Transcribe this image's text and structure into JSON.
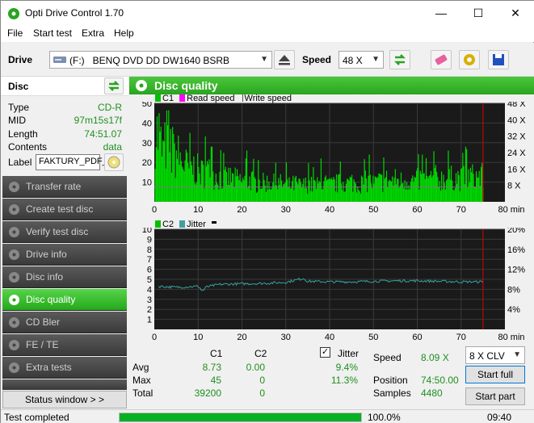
{
  "window": {
    "title": "Opti Drive Control 1.70"
  },
  "menu": [
    "File",
    "Start test",
    "Extra",
    "Help"
  ],
  "toolbar": {
    "drive_label": "Drive",
    "drive_value": "(F:)   BENQ DVD DD DW1640 BSRB",
    "speed_label": "Speed",
    "speed_value": "48 X"
  },
  "disc": {
    "header": "Disc",
    "type_label": "Type",
    "type_value": "CD-R",
    "mid_label": "MID",
    "mid_value": "97m15s17f",
    "length_label": "Length",
    "length_value": "74:51.07",
    "contents_label": "Contents",
    "contents_value": "data",
    "label_label": "Label",
    "label_value": "FAKTURY_PDF_"
  },
  "nav": [
    "Transfer rate",
    "Create test disc",
    "Verify test disc",
    "Drive info",
    "Disc info",
    "Disc quality",
    "CD Bler",
    "FE / TE",
    "Extra tests"
  ],
  "status_window_label": "Status window > >",
  "main": {
    "title": "Disc quality",
    "legend1": {
      "c1": "C1",
      "read": "Read speed",
      "write": "Write speed"
    },
    "legend2": {
      "c2": "C2",
      "jitter": "Jitter"
    },
    "stats": {
      "col_c1": "C1",
      "col_c2": "C2",
      "jitter_label": "Jitter",
      "avg_label": "Avg",
      "avg_c1": "8.73",
      "avg_c2": "0.00",
      "avg_jitter": "9.4%",
      "max_label": "Max",
      "max_c1": "45",
      "max_c2": "0",
      "max_jitter": "11.3%",
      "total_label": "Total",
      "total_c1": "39200",
      "total_c2": "0",
      "speed_label": "Speed",
      "speed_value": "8.09 X",
      "position_label": "Position",
      "position_value": "74:50.00",
      "samples_label": "Samples",
      "samples_value": "4480",
      "speed_select": "8 X CLV",
      "start_full": "Start full",
      "start_part": "Start part"
    }
  },
  "status": {
    "text": "Test completed",
    "progress_label": "100.0%",
    "progress": 1.0,
    "time": "09:40"
  },
  "colors": {
    "accent_green": "#2aa41f",
    "c1_bar": "#00e000",
    "jitter_line": "#40a0a0",
    "read_speed": "#ff00ff",
    "position_marker": "#e00000"
  },
  "chart_data": [
    {
      "type": "bar",
      "title": "",
      "series": [
        {
          "name": "C1",
          "description": "dense bars, avg 8.73, max 45",
          "color": "#00e000"
        },
        {
          "name": "Read speed",
          "color": "#ff00ff"
        },
        {
          "name": "Write speed",
          "color": "#ffffff"
        }
      ],
      "x_ticks": [
        "0",
        "10",
        "20",
        "30",
        "40",
        "50",
        "60",
        "70",
        "80 min"
      ],
      "y_ticks": [
        "10",
        "20",
        "30",
        "40",
        "50"
      ],
      "y2_ticks": [
        "8 X",
        "16 X",
        "24 X",
        "32 X",
        "40 X",
        "48 X"
      ],
      "xlim": [
        0,
        80
      ],
      "ylim": [
        0,
        50
      ],
      "end_marker": 75,
      "c1_profile": [
        [
          0,
          38
        ],
        [
          1,
          30
        ],
        [
          2,
          24
        ],
        [
          3,
          33
        ],
        [
          4,
          22
        ],
        [
          5,
          24
        ],
        [
          6,
          20
        ],
        [
          7,
          18
        ],
        [
          8,
          16
        ],
        [
          9,
          17
        ],
        [
          10,
          15
        ],
        [
          11,
          14
        ],
        [
          12,
          16
        ],
        [
          13,
          13
        ],
        [
          14,
          13
        ],
        [
          15,
          12
        ],
        [
          16,
          11
        ],
        [
          17,
          12
        ],
        [
          18,
          11
        ],
        [
          19,
          11
        ],
        [
          20,
          10
        ],
        [
          21,
          10
        ],
        [
          22,
          11
        ],
        [
          23,
          9
        ],
        [
          24,
          10
        ],
        [
          25,
          9
        ],
        [
          26,
          10
        ],
        [
          27,
          9
        ],
        [
          28,
          9
        ],
        [
          29,
          9
        ],
        [
          30,
          8
        ],
        [
          31,
          8
        ],
        [
          32,
          9
        ],
        [
          33,
          8
        ],
        [
          34,
          8
        ],
        [
          35,
          9
        ],
        [
          36,
          8
        ],
        [
          37,
          8
        ],
        [
          38,
          9
        ],
        [
          39,
          9
        ],
        [
          40,
          8
        ],
        [
          41,
          9
        ],
        [
          42,
          9
        ],
        [
          43,
          10
        ],
        [
          44,
          9
        ],
        [
          45,
          10
        ],
        [
          46,
          9
        ],
        [
          47,
          9
        ],
        [
          48,
          10
        ],
        [
          49,
          10
        ],
        [
          50,
          9
        ],
        [
          51,
          10
        ],
        [
          52,
          10
        ],
        [
          53,
          11
        ],
        [
          54,
          10
        ],
        [
          55,
          11
        ],
        [
          56,
          10
        ],
        [
          57,
          11
        ],
        [
          58,
          11
        ],
        [
          59,
          10
        ],
        [
          60,
          11
        ],
        [
          61,
          11
        ],
        [
          62,
          10
        ],
        [
          63,
          11
        ],
        [
          64,
          12
        ],
        [
          65,
          11
        ],
        [
          66,
          12
        ],
        [
          67,
          11
        ],
        [
          68,
          12
        ],
        [
          69,
          12
        ],
        [
          70,
          11
        ],
        [
          71,
          12
        ],
        [
          72,
          13
        ],
        [
          73,
          12
        ],
        [
          74,
          13
        ],
        [
          75,
          12
        ]
      ],
      "peaks": [
        [
          1,
          45
        ],
        [
          4,
          38
        ],
        [
          8,
          35
        ],
        [
          13,
          28
        ],
        [
          21,
          26
        ],
        [
          30,
          20
        ],
        [
          38,
          22
        ],
        [
          49,
          24
        ],
        [
          61,
          24
        ],
        [
          67,
          26
        ],
        [
          71,
          28
        ]
      ]
    },
    {
      "type": "line",
      "title": "",
      "series": [
        {
          "name": "C2",
          "values": "all 0",
          "color": "#00e000"
        },
        {
          "name": "Jitter",
          "color": "#40a0a0",
          "avg": 9.4,
          "max": 11.3
        }
      ],
      "x_ticks": [
        "0",
        "10",
        "20",
        "30",
        "40",
        "50",
        "60",
        "70",
        "80 min"
      ],
      "y_ticks": [
        "1",
        "2",
        "3",
        "4",
        "5",
        "6",
        "7",
        "8",
        "9",
        "10"
      ],
      "y2_ticks": [
        "4%",
        "8%",
        "12%",
        "16%",
        "20%"
      ],
      "xlim": [
        0,
        80
      ],
      "ylim": [
        0,
        10
      ],
      "end_marker": 75,
      "jitter_profile": [
        [
          1,
          8.6
        ],
        [
          5,
          8.4
        ],
        [
          10,
          8.6
        ],
        [
          11,
          7.8
        ],
        [
          12,
          8.5
        ],
        [
          15,
          9.0
        ],
        [
          20,
          9.1
        ],
        [
          25,
          9.2
        ],
        [
          30,
          9.4
        ],
        [
          34,
          10.2
        ],
        [
          35,
          9.6
        ],
        [
          40,
          9.5
        ],
        [
          45,
          9.5
        ],
        [
          50,
          9.6
        ],
        [
          55,
          9.7
        ],
        [
          60,
          9.7
        ],
        [
          65,
          9.6
        ],
        [
          70,
          9.5
        ],
        [
          75,
          9.5
        ]
      ]
    }
  ]
}
